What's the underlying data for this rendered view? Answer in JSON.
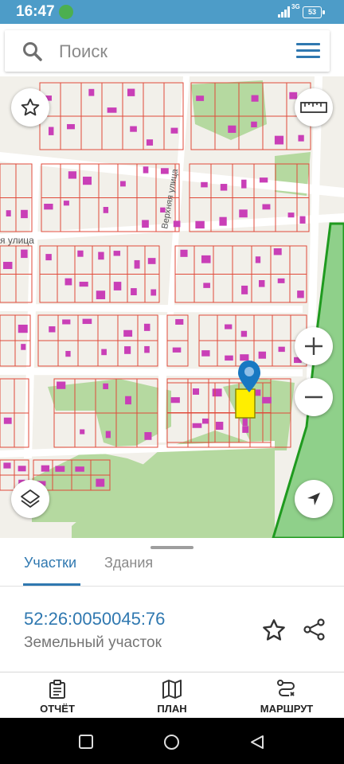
{
  "status_bar": {
    "time": "16:47",
    "network": "3G",
    "battery": "53"
  },
  "search": {
    "placeholder": "Поиск"
  },
  "map": {
    "street_labels": [
      "Верхняя улица",
      "я улица"
    ],
    "colors": {
      "parcel": "#e04a3a",
      "building": "#c93fb7",
      "selected": "#ffee00",
      "forest": "#1f9a1f",
      "pin": "#1878c2"
    }
  },
  "tabs": [
    {
      "label": "Участки",
      "active": true
    },
    {
      "label": "Здания",
      "active": false
    }
  ],
  "parcel": {
    "cadastral_number": "52:26:0050045:76",
    "type": "Земельный участок"
  },
  "bottom_nav": [
    {
      "label": "ОТЧЁТ",
      "icon": "clipboard-icon"
    },
    {
      "label": "ПЛАН",
      "icon": "map-icon"
    },
    {
      "label": "МАРШРУТ",
      "icon": "route-icon"
    }
  ]
}
